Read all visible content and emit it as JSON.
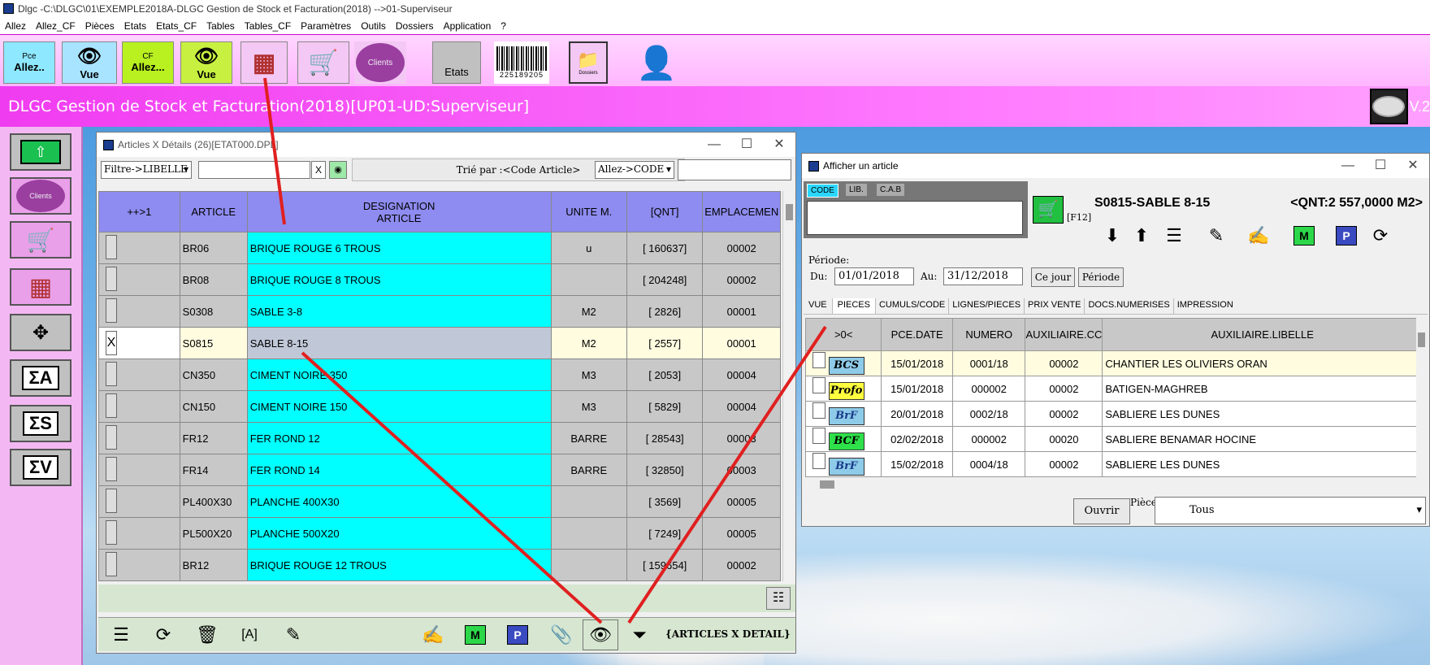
{
  "window_title": "Dlgc -C:\\DLGC\\01\\EXEMPLE2018A-DLGC Gestion de Stock et Facturation(2018) -->01-Superviseur",
  "menu": [
    "Allez",
    "Allez_CF",
    "Pièces",
    "Etats",
    "Etats_CF",
    "Tables",
    "Tables_CF",
    "Paramètres",
    "Outils",
    "Dossiers",
    "Application",
    "?"
  ],
  "toolbar": {
    "pce_label": "Pce",
    "allez_label": "Allez..",
    "vue_label": "Vue",
    "cf_label": "CF",
    "allez2_label": "Allez...",
    "vue2_label": "Vue",
    "clients_label": "Clients",
    "etats_label": "Etats",
    "barcode_label": "225189205",
    "dossiers_label": "Dossiers"
  },
  "banner": {
    "title": "DLGC Gestion de Stock et Facturation(2018)[UP01-UD:Superviseur]",
    "version": "V.2"
  },
  "left_panel": {
    "clients_label": "Clients",
    "sigma_a": "ΣA",
    "sigma_s": "ΣS",
    "sigma_v": "ΣV"
  },
  "articles_window": {
    "title": "Articles X Détails (26)[ETAT000.DPL]",
    "filter_select": "Filtre->LIBELLE",
    "filter_value": "",
    "clear_label": "X",
    "sort_label": "Trié par :<Code Article>",
    "goto_select": "Allez->CODE",
    "goto_value": "",
    "columns": [
      "++>1",
      "ARTICLE",
      "DESIGNATION\nARTICLE",
      "UNITE M.",
      "[QNT]",
      "EMPLACEMEN"
    ],
    "col_designation_1": "DESIGNATION",
    "col_designation_2": "ARTICLE",
    "rows": [
      {
        "check": "",
        "code": "BR06",
        "designation": "BRIQUE ROUGE 6 TROUS",
        "unite": "u",
        "qnt": "[ 160637]",
        "emplacement": "00002"
      },
      {
        "check": "",
        "code": "BR08",
        "designation": "BRIQUE ROUGE 8 TROUS",
        "unite": "",
        "qnt": "[ 204248]",
        "emplacement": "00002"
      },
      {
        "check": "",
        "code": "S0308",
        "designation": "SABLE 3-8",
        "unite": "M2",
        "qnt": "[ 2826]",
        "emplacement": "00001"
      },
      {
        "check": "X",
        "code": "S0815",
        "designation": "SABLE 8-15",
        "unite": "M2",
        "qnt": "[ 2557]",
        "emplacement": "00001"
      },
      {
        "check": "",
        "code": "CN350",
        "designation": "CIMENT NOIRE 350",
        "unite": "M3",
        "qnt": "[ 2053]",
        "emplacement": "00004"
      },
      {
        "check": "",
        "code": "CN150",
        "designation": "CIMENT NOIRE 150",
        "unite": "M3",
        "qnt": "[ 5829]",
        "emplacement": "00004"
      },
      {
        "check": "",
        "code": "FR12",
        "designation": "FER ROND 12",
        "unite": "BARRE",
        "qnt": "[ 28543]",
        "emplacement": "00003"
      },
      {
        "check": "",
        "code": "FR14",
        "designation": "FER ROND 14",
        "unite": "BARRE",
        "qnt": "[ 32850]",
        "emplacement": "00003"
      },
      {
        "check": "",
        "code": "PL400X30",
        "designation": "PLANCHE 400X30",
        "unite": "",
        "qnt": "[ 3569]",
        "emplacement": "00005"
      },
      {
        "check": "",
        "code": "PL500X20",
        "designation": "PLANCHE 500X20",
        "unite": "",
        "qnt": "[ 7249]",
        "emplacement": "00005"
      },
      {
        "check": "",
        "code": "BR12",
        "designation": "BRIQUE ROUGE 12 TROUS",
        "unite": "",
        "qnt": "[ 159654]",
        "emplacement": "00002"
      }
    ],
    "footer_label": "{ARTICLES X DETAIL}"
  },
  "article_window": {
    "title": "Afficher un article",
    "tabs_top": [
      "CODE",
      "LIB.",
      "C.A.B"
    ],
    "code_value": "",
    "f12_label": "[F12]",
    "article_name": "S0815-SABLE 8-15",
    "qnt_label": "<QNT:2 557,0000 M2>",
    "periode_label": "Période:",
    "du_label": "Du:",
    "du_value": "01/01/2018",
    "au_label": "Au:",
    "au_value": "31/12/2018",
    "ce_jour_label": "Ce jour",
    "periode_btn": "Période",
    "tabs": [
      "VUE",
      "PIECES",
      "CUMULS/CODE",
      "LIGNES/PIECES",
      "PRIX VENTE",
      "DOCS.NUMERISES",
      "IMPRESSION"
    ],
    "columns": [
      ">0<",
      "PCE.DATE",
      "NUMERO",
      "AUXILIAIRE.CC",
      "AUXILIAIRE.LIBELLE"
    ],
    "rows": [
      {
        "type": "BCS",
        "date": "15/01/2018",
        "numero": "0001/18",
        "aux_cc": "00002",
        "aux_lib": "CHANTIER LES OLIVIERS ORAN"
      },
      {
        "type": "Profo",
        "date": "15/01/2018",
        "numero": "000002",
        "aux_cc": "00002",
        "aux_lib": "BATIGEN-MAGHREB"
      },
      {
        "type": "BrF",
        "date": "20/01/2018",
        "numero": "0002/18",
        "aux_cc": "00002",
        "aux_lib": "SABLIERE LES DUNES"
      },
      {
        "type": "BCF",
        "date": "02/02/2018",
        "numero": "000002",
        "aux_cc": "00020",
        "aux_lib": "SABLIERE BENAMAR HOCINE"
      },
      {
        "type": "BrF",
        "date": "15/02/2018",
        "numero": "0004/18",
        "aux_cc": "00002",
        "aux_lib": "SABLIERE LES DUNES"
      }
    ],
    "ouvrir_label": "Ouvrir",
    "piece_label": "Pièce:",
    "piece_value": "Tous"
  },
  "colors": {
    "accent": "#ff66ff",
    "banner": "#f03cf0",
    "cyan": "#00ffff",
    "header": "#8e8cf0",
    "arrow": "#e02020"
  }
}
